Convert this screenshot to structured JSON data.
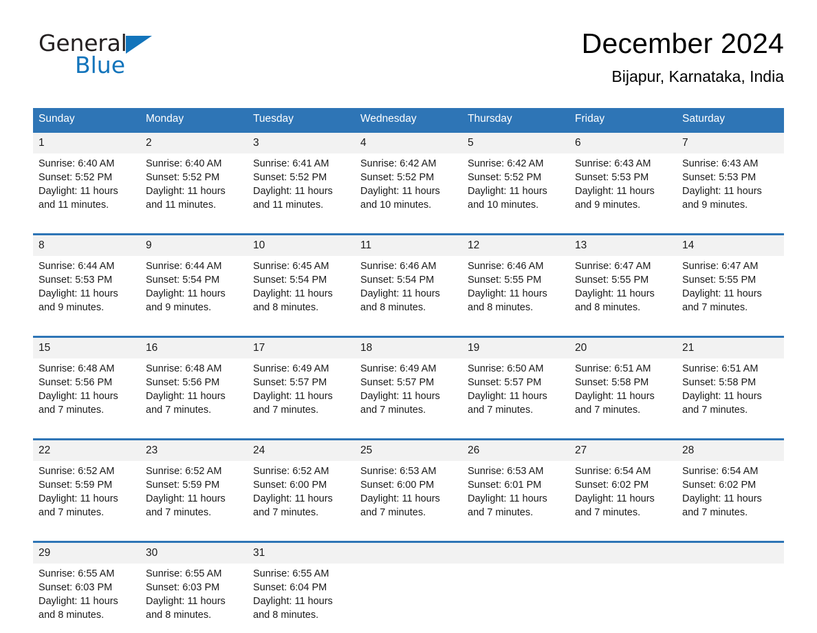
{
  "brand": {
    "name_part1": "General",
    "name_part2": "Blue",
    "triangle_color": "#1274bb"
  },
  "header": {
    "title": "December 2024",
    "subtitle": "Bijapur, Karnataka, India"
  },
  "theme": {
    "header_blue": "#2e75b6",
    "daynum_gray": "#f2f2f2",
    "text_black": "#1a1a1a"
  },
  "weekday_headers": [
    "Sunday",
    "Monday",
    "Tuesday",
    "Wednesday",
    "Thursday",
    "Friday",
    "Saturday"
  ],
  "weeks": [
    {
      "days": [
        {
          "num": "1",
          "sunrise": "Sunrise: 6:40 AM",
          "sunset": "Sunset: 5:52 PM",
          "daylight1": "Daylight: 11 hours",
          "daylight2": "and 11 minutes."
        },
        {
          "num": "2",
          "sunrise": "Sunrise: 6:40 AM",
          "sunset": "Sunset: 5:52 PM",
          "daylight1": "Daylight: 11 hours",
          "daylight2": "and 11 minutes."
        },
        {
          "num": "3",
          "sunrise": "Sunrise: 6:41 AM",
          "sunset": "Sunset: 5:52 PM",
          "daylight1": "Daylight: 11 hours",
          "daylight2": "and 11 minutes."
        },
        {
          "num": "4",
          "sunrise": "Sunrise: 6:42 AM",
          "sunset": "Sunset: 5:52 PM",
          "daylight1": "Daylight: 11 hours",
          "daylight2": "and 10 minutes."
        },
        {
          "num": "5",
          "sunrise": "Sunrise: 6:42 AM",
          "sunset": "Sunset: 5:52 PM",
          "daylight1": "Daylight: 11 hours",
          "daylight2": "and 10 minutes."
        },
        {
          "num": "6",
          "sunrise": "Sunrise: 6:43 AM",
          "sunset": "Sunset: 5:53 PM",
          "daylight1": "Daylight: 11 hours",
          "daylight2": "and 9 minutes."
        },
        {
          "num": "7",
          "sunrise": "Sunrise: 6:43 AM",
          "sunset": "Sunset: 5:53 PM",
          "daylight1": "Daylight: 11 hours",
          "daylight2": "and 9 minutes."
        }
      ]
    },
    {
      "days": [
        {
          "num": "8",
          "sunrise": "Sunrise: 6:44 AM",
          "sunset": "Sunset: 5:53 PM",
          "daylight1": "Daylight: 11 hours",
          "daylight2": "and 9 minutes."
        },
        {
          "num": "9",
          "sunrise": "Sunrise: 6:44 AM",
          "sunset": "Sunset: 5:54 PM",
          "daylight1": "Daylight: 11 hours",
          "daylight2": "and 9 minutes."
        },
        {
          "num": "10",
          "sunrise": "Sunrise: 6:45 AM",
          "sunset": "Sunset: 5:54 PM",
          "daylight1": "Daylight: 11 hours",
          "daylight2": "and 8 minutes."
        },
        {
          "num": "11",
          "sunrise": "Sunrise: 6:46 AM",
          "sunset": "Sunset: 5:54 PM",
          "daylight1": "Daylight: 11 hours",
          "daylight2": "and 8 minutes."
        },
        {
          "num": "12",
          "sunrise": "Sunrise: 6:46 AM",
          "sunset": "Sunset: 5:55 PM",
          "daylight1": "Daylight: 11 hours",
          "daylight2": "and 8 minutes."
        },
        {
          "num": "13",
          "sunrise": "Sunrise: 6:47 AM",
          "sunset": "Sunset: 5:55 PM",
          "daylight1": "Daylight: 11 hours",
          "daylight2": "and 8 minutes."
        },
        {
          "num": "14",
          "sunrise": "Sunrise: 6:47 AM",
          "sunset": "Sunset: 5:55 PM",
          "daylight1": "Daylight: 11 hours",
          "daylight2": "and 7 minutes."
        }
      ]
    },
    {
      "days": [
        {
          "num": "15",
          "sunrise": "Sunrise: 6:48 AM",
          "sunset": "Sunset: 5:56 PM",
          "daylight1": "Daylight: 11 hours",
          "daylight2": "and 7 minutes."
        },
        {
          "num": "16",
          "sunrise": "Sunrise: 6:48 AM",
          "sunset": "Sunset: 5:56 PM",
          "daylight1": "Daylight: 11 hours",
          "daylight2": "and 7 minutes."
        },
        {
          "num": "17",
          "sunrise": "Sunrise: 6:49 AM",
          "sunset": "Sunset: 5:57 PM",
          "daylight1": "Daylight: 11 hours",
          "daylight2": "and 7 minutes."
        },
        {
          "num": "18",
          "sunrise": "Sunrise: 6:49 AM",
          "sunset": "Sunset: 5:57 PM",
          "daylight1": "Daylight: 11 hours",
          "daylight2": "and 7 minutes."
        },
        {
          "num": "19",
          "sunrise": "Sunrise: 6:50 AM",
          "sunset": "Sunset: 5:57 PM",
          "daylight1": "Daylight: 11 hours",
          "daylight2": "and 7 minutes."
        },
        {
          "num": "20",
          "sunrise": "Sunrise: 6:51 AM",
          "sunset": "Sunset: 5:58 PM",
          "daylight1": "Daylight: 11 hours",
          "daylight2": "and 7 minutes."
        },
        {
          "num": "21",
          "sunrise": "Sunrise: 6:51 AM",
          "sunset": "Sunset: 5:58 PM",
          "daylight1": "Daylight: 11 hours",
          "daylight2": "and 7 minutes."
        }
      ]
    },
    {
      "days": [
        {
          "num": "22",
          "sunrise": "Sunrise: 6:52 AM",
          "sunset": "Sunset: 5:59 PM",
          "daylight1": "Daylight: 11 hours",
          "daylight2": "and 7 minutes."
        },
        {
          "num": "23",
          "sunrise": "Sunrise: 6:52 AM",
          "sunset": "Sunset: 5:59 PM",
          "daylight1": "Daylight: 11 hours",
          "daylight2": "and 7 minutes."
        },
        {
          "num": "24",
          "sunrise": "Sunrise: 6:52 AM",
          "sunset": "Sunset: 6:00 PM",
          "daylight1": "Daylight: 11 hours",
          "daylight2": "and 7 minutes."
        },
        {
          "num": "25",
          "sunrise": "Sunrise: 6:53 AM",
          "sunset": "Sunset: 6:00 PM",
          "daylight1": "Daylight: 11 hours",
          "daylight2": "and 7 minutes."
        },
        {
          "num": "26",
          "sunrise": "Sunrise: 6:53 AM",
          "sunset": "Sunset: 6:01 PM",
          "daylight1": "Daylight: 11 hours",
          "daylight2": "and 7 minutes."
        },
        {
          "num": "27",
          "sunrise": "Sunrise: 6:54 AM",
          "sunset": "Sunset: 6:02 PM",
          "daylight1": "Daylight: 11 hours",
          "daylight2": "and 7 minutes."
        },
        {
          "num": "28",
          "sunrise": "Sunrise: 6:54 AM",
          "sunset": "Sunset: 6:02 PM",
          "daylight1": "Daylight: 11 hours",
          "daylight2": "and 7 minutes."
        }
      ]
    },
    {
      "days": [
        {
          "num": "29",
          "sunrise": "Sunrise: 6:55 AM",
          "sunset": "Sunset: 6:03 PM",
          "daylight1": "Daylight: 11 hours",
          "daylight2": "and 8 minutes."
        },
        {
          "num": "30",
          "sunrise": "Sunrise: 6:55 AM",
          "sunset": "Sunset: 6:03 PM",
          "daylight1": "Daylight: 11 hours",
          "daylight2": "and 8 minutes."
        },
        {
          "num": "31",
          "sunrise": "Sunrise: 6:55 AM",
          "sunset": "Sunset: 6:04 PM",
          "daylight1": "Daylight: 11 hours",
          "daylight2": "and 8 minutes."
        },
        {
          "num": "",
          "sunrise": "",
          "sunset": "",
          "daylight1": "",
          "daylight2": ""
        },
        {
          "num": "",
          "sunrise": "",
          "sunset": "",
          "daylight1": "",
          "daylight2": ""
        },
        {
          "num": "",
          "sunrise": "",
          "sunset": "",
          "daylight1": "",
          "daylight2": ""
        },
        {
          "num": "",
          "sunrise": "",
          "sunset": "",
          "daylight1": "",
          "daylight2": ""
        }
      ]
    }
  ]
}
